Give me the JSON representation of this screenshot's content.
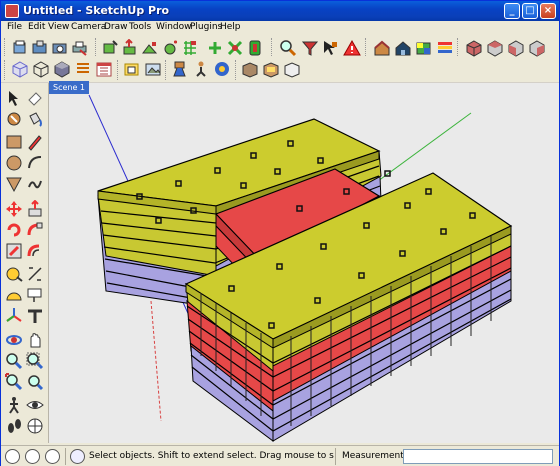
{
  "app": {
    "title": "Untitled - SketchUp Pro"
  },
  "window_buttons": {
    "minimize": "_",
    "maximize": "□",
    "close": "×"
  },
  "menu": [
    "File",
    "Edit",
    "View",
    "Camera",
    "Draw",
    "Tools",
    "Window",
    "Plugins",
    "Help"
  ],
  "scene_tab": "Scene 1",
  "status": {
    "message": "Select objects. Shift to extend select. Drag mouse to s",
    "measurements_label": "Measurements",
    "measurements_value": ""
  },
  "colors": {
    "roof_yellow": "#c8c832",
    "accent_red": "#e84a4a",
    "floor_purple": "#a49ee0",
    "sky": "#eaeaea"
  }
}
